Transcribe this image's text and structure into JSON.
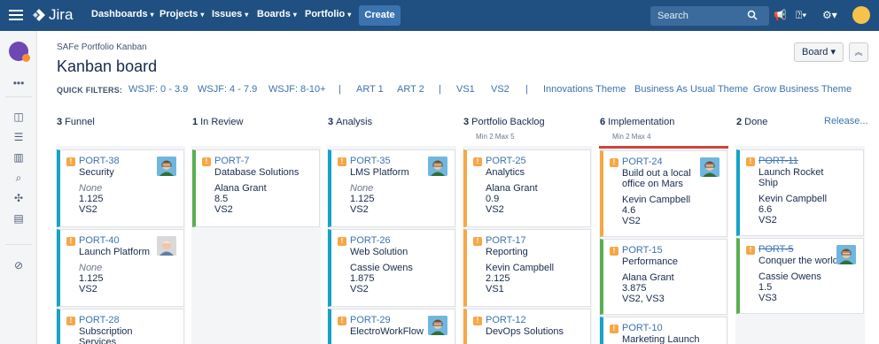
{
  "nav": {
    "logo": "Jira",
    "items": [
      "Dashboards",
      "Projects",
      "Issues",
      "Boards",
      "Portfolio"
    ],
    "create": "Create",
    "search_placeholder": "Search"
  },
  "header": {
    "breadcrumb": "SAFe Portfolio Kanban",
    "title": "Kanban board",
    "board_button": "Board",
    "quick_filters_label": "QUICK FILTERS:",
    "quick_filters": [
      "WSJF: 0 - 3.9",
      "WSJF: 4 - 7.9",
      "WSJF: 8-10+",
      "ART 1",
      "ART 2",
      "VS1",
      "VS2",
      "Innovations Theme",
      "Business As Usual Theme",
      "Grow Business Theme"
    ]
  },
  "columns": [
    {
      "count": "3",
      "name": "Funnel",
      "constraint": ""
    },
    {
      "count": "1",
      "name": "In Review",
      "constraint": ""
    },
    {
      "count": "3",
      "name": "Analysis",
      "constraint": ""
    },
    {
      "count": "3",
      "name": "Portfolio Backlog",
      "constraint": "Min 2   Max 5"
    },
    {
      "count": "6",
      "name": "Implementation",
      "constraint": "Min 2   Max 4"
    },
    {
      "count": "2",
      "name": "Done",
      "constraint": ""
    }
  ],
  "release_link": "Release...",
  "cards": [
    {
      "key": "PORT-38",
      "summary": "Security",
      "assignee": "None",
      "score": "1.125",
      "vs": "VS2"
    },
    {
      "key": "PORT-40",
      "summary": "Launch Platform",
      "assignee": "None",
      "score": "1.125",
      "vs": "VS2"
    },
    {
      "key": "PORT-28",
      "summary": "Subscription Services"
    },
    {
      "key": "PORT-7",
      "summary": "Database Solutions",
      "assignee": "Alana Grant",
      "score": "8.5",
      "vs": "VS2"
    },
    {
      "key": "PORT-35",
      "summary": "LMS Platform",
      "assignee": "None",
      "score": "1.125",
      "vs": "VS2"
    },
    {
      "key": "PORT-26",
      "summary": "Web Solution",
      "assignee": "Cassie Owens",
      "score": "1.875",
      "vs": "VS2"
    },
    {
      "key": "PORT-29",
      "summary": "ElectroWorkFlow"
    },
    {
      "key": "PORT-25",
      "summary": "Analytics",
      "assignee": "Alana Grant",
      "score": "0.9",
      "vs": "VS2"
    },
    {
      "key": "PORT-17",
      "summary": "Reporting",
      "assignee": "Kevin Campbell",
      "score": "2.125",
      "vs": "VS1"
    },
    {
      "key": "PORT-12",
      "summary": "DevOps Solutions"
    },
    {
      "key": "PORT-24",
      "summary": "Build out a local office on Mars",
      "assignee": "Kevin Campbell",
      "score": "4.6",
      "vs": "VS2"
    },
    {
      "key": "PORT-15",
      "summary": "Performance",
      "assignee": "Alana Grant",
      "score": "3.875",
      "vs": "VS2, VS3"
    },
    {
      "key": "PORT-10",
      "summary": "Marketing Launch"
    },
    {
      "key": "PORT-11",
      "summary": "Launch Rocket Ship",
      "assignee": "Kevin Campbell",
      "score": "6.6",
      "vs": "VS2"
    },
    {
      "key": "PORT-5",
      "summary": "Conquer the world",
      "assignee": "Cassie Owens",
      "score": "1.5",
      "vs": "VS3"
    }
  ],
  "colors": {
    "nav": "#205081",
    "link": "#3b73af",
    "priority": "#f6a745",
    "red_limit": "#d04437"
  }
}
